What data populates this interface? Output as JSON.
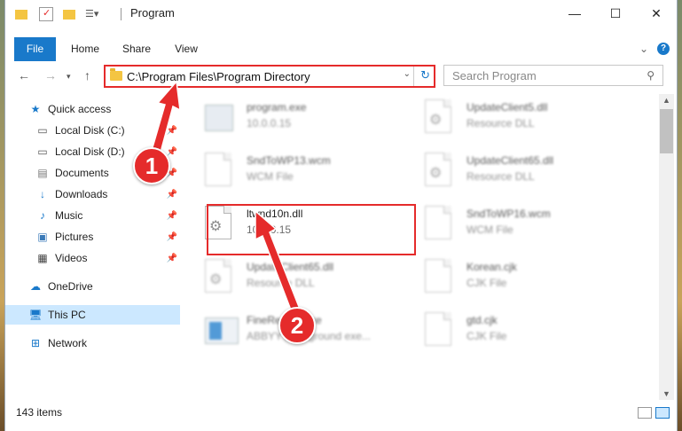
{
  "window": {
    "title": "Program",
    "controls": {
      "minimize": "—",
      "maximize": "☐",
      "close": "✕"
    }
  },
  "ribbon": {
    "tabs": [
      "File",
      "Home",
      "Share",
      "View"
    ]
  },
  "address_bar": {
    "path": "C:\\Program Files\\Program Directory"
  },
  "search": {
    "placeholder": "Search Program"
  },
  "sidebar": {
    "items": [
      {
        "label": "Quick access",
        "icon": "star-icon"
      },
      {
        "label": "Local Disk (C:)",
        "icon": "drive-icon",
        "pinned": true
      },
      {
        "label": "Local Disk (D:)",
        "icon": "drive-icon",
        "pinned": true
      },
      {
        "label": "Documents",
        "icon": "documents-icon",
        "pinned": true
      },
      {
        "label": "Downloads",
        "icon": "download-icon",
        "pinned": true
      },
      {
        "label": "Music",
        "icon": "music-icon",
        "pinned": true
      },
      {
        "label": "Pictures",
        "icon": "pictures-icon",
        "pinned": true
      },
      {
        "label": "Videos",
        "icon": "videos-icon",
        "pinned": true
      },
      {
        "label": "OneDrive",
        "icon": "cloud-icon"
      },
      {
        "label": "This PC",
        "icon": "computer-icon",
        "selected": true
      },
      {
        "label": "Network",
        "icon": "network-icon"
      }
    ]
  },
  "files": [
    {
      "name": "program.exe",
      "sub": "10.0.0.15",
      "icon": "exe-icon",
      "blurred": true
    },
    {
      "name": "UpdateClient5.dll",
      "sub": "Resource DLL",
      "icon": "dll-icon",
      "blurred": true
    },
    {
      "name": "SndToWP13.wcm",
      "sub": "WCM File",
      "icon": "file-icon",
      "blurred": true
    },
    {
      "name": "UpdateClient65.dll",
      "sub": "Resource DLL",
      "icon": "dll-icon",
      "blurred": true
    },
    {
      "name": "ltwnd10n.dll",
      "sub": "10.0.0.15",
      "icon": "dll-icon",
      "blurred": false
    },
    {
      "name": "SndToWP16.wcm",
      "sub": "WCM File",
      "icon": "file-icon",
      "blurred": true
    },
    {
      "name": "UpdateClient65.dll",
      "sub": "Resource DLL",
      "icon": "dll-icon",
      "blurred": true
    },
    {
      "name": "Korean.cjk",
      "sub": "CJK File",
      "icon": "file-icon",
      "blurred": true
    },
    {
      "name": "FineReader.exe",
      "sub": "ABBYY Background exe...",
      "icon": "exe-icon",
      "blurred": true
    },
    {
      "name": "gtd.cjk",
      "sub": "CJK File",
      "icon": "file-icon",
      "blurred": true
    }
  ],
  "status": {
    "item_count": "143 items"
  },
  "annotations": {
    "badge1": "1",
    "badge2": "2",
    "accent": "#e52b2b"
  }
}
